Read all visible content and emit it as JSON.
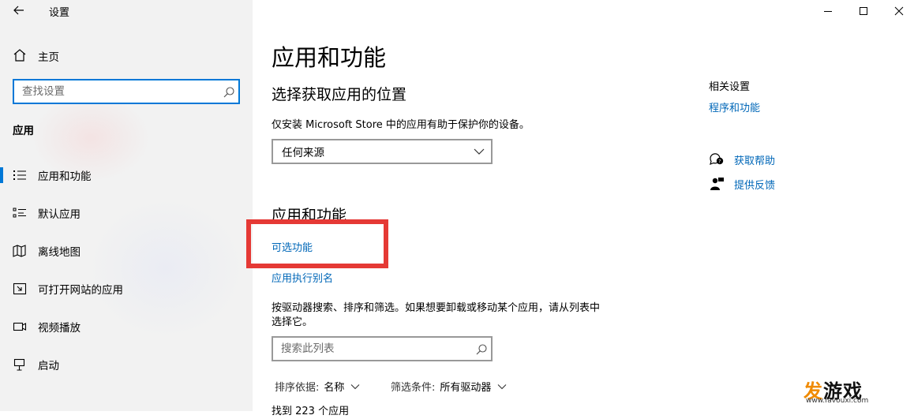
{
  "window": {
    "title": "设置"
  },
  "sidebar": {
    "home_label": "主页",
    "search_placeholder": "查找设置",
    "section_title": "应用",
    "items": [
      {
        "label": "应用和功能",
        "icon": "apps-list-icon",
        "selected": true
      },
      {
        "label": "默认应用",
        "icon": "default-apps-icon",
        "selected": false
      },
      {
        "label": "离线地图",
        "icon": "offline-maps-icon",
        "selected": false
      },
      {
        "label": "可打开网站的应用",
        "icon": "open-website-icon",
        "selected": false
      },
      {
        "label": "视频播放",
        "icon": "video-playback-icon",
        "selected": false
      },
      {
        "label": "启动",
        "icon": "startup-icon",
        "selected": false
      }
    ]
  },
  "main": {
    "page_title": "应用和功能",
    "install_section_title": "选择获取应用的位置",
    "install_description": "仅安装 Microsoft Store 中的应用有助于保护你的设备。",
    "install_source_value": "任何来源",
    "apps_section_title": "应用和功能",
    "optional_features_link": "可选功能",
    "app_alias_link": "应用执行别名",
    "search_description_line1": "按驱动器搜索、排序和筛选。如果想要卸载或移动某个应用，请从列表中",
    "search_description_line2": "选择它。",
    "list_search_placeholder": "搜索此列表",
    "sort_label": "排序依据:",
    "sort_value": "名称",
    "filter_label": "筛选条件:",
    "filter_value": "所有驱动器",
    "found_count_partial": "找到 223 个应用"
  },
  "related": {
    "title": "相关设置",
    "programs_link": "程序和功能",
    "help_link": "获取帮助",
    "feedback_link": "提供反馈"
  },
  "watermark": {
    "char1": "发",
    "rest": "游戏",
    "url": "www.favouxi.com"
  },
  "colors": {
    "accent": "#0078d7",
    "link": "#0067b8",
    "highlight_box": "#e53935",
    "watermark_orange": "#f08a00"
  }
}
